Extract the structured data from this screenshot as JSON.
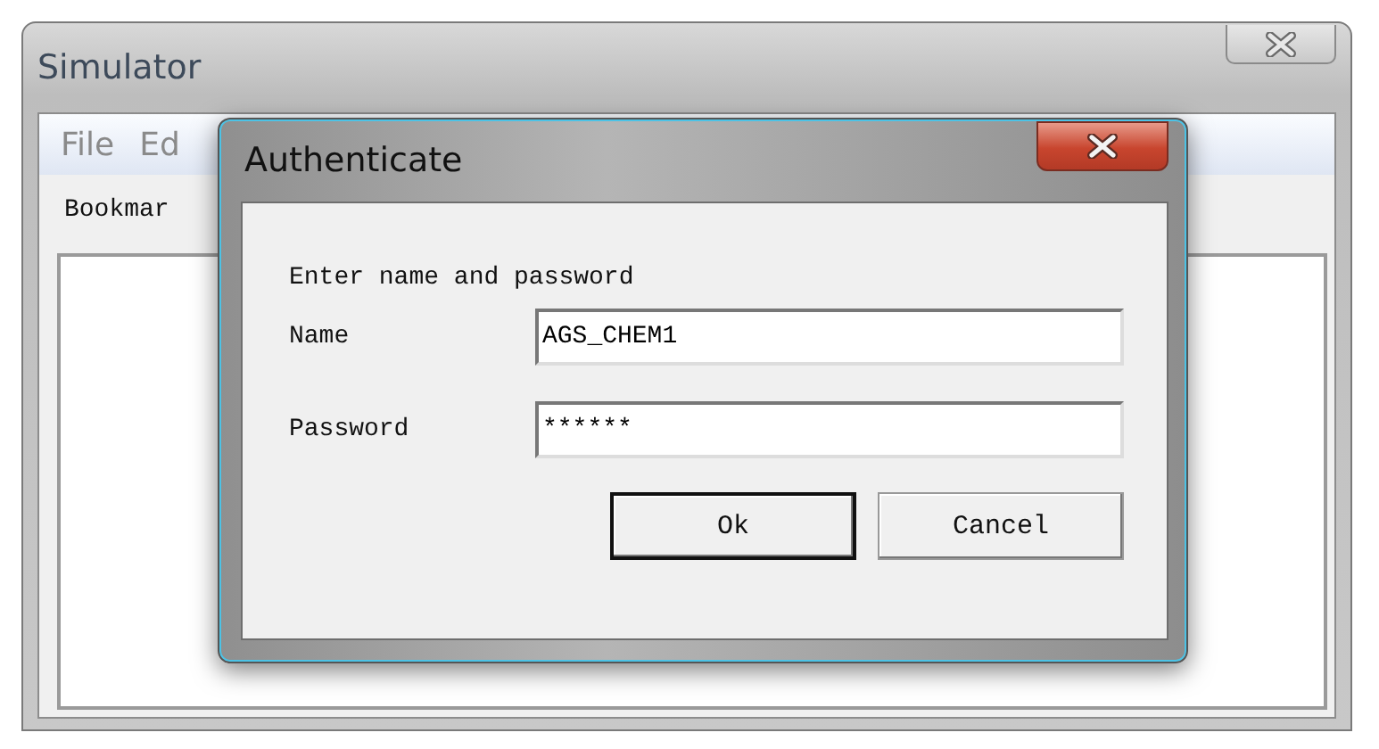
{
  "window": {
    "title": "Simulator"
  },
  "menu": [
    "File",
    "Ed"
  ],
  "tabs": [
    {
      "label": "Bookmar",
      "selected": true
    }
  ],
  "dialog": {
    "title": "Authenticate",
    "prompt": "Enter name and password",
    "fields": [
      {
        "label": "Name",
        "value": "AGS_CHEM1"
      },
      {
        "label": "Password",
        "value": "******"
      }
    ],
    "buttons": [
      {
        "label": "Ok",
        "default": true
      },
      {
        "label": "Cancel",
        "default": false
      }
    ]
  }
}
